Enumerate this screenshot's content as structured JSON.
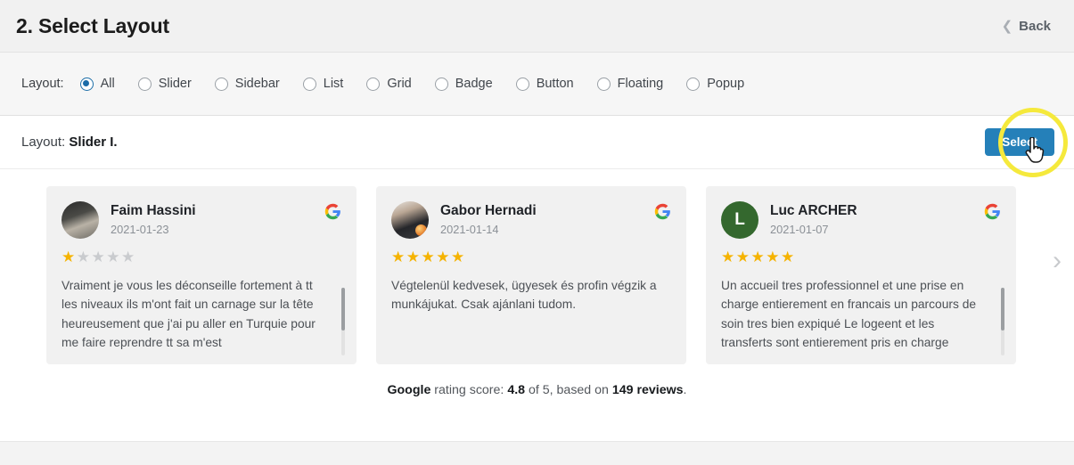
{
  "header": {
    "title": "2. Select Layout",
    "back_label": "Back",
    "back_chevron": "chevron-left"
  },
  "filter": {
    "label": "Layout:",
    "options": [
      {
        "label": "All",
        "checked": true
      },
      {
        "label": "Slider",
        "checked": false
      },
      {
        "label": "Sidebar",
        "checked": false
      },
      {
        "label": "List",
        "checked": false
      },
      {
        "label": "Grid",
        "checked": false
      },
      {
        "label": "Badge",
        "checked": false
      },
      {
        "label": "Button",
        "checked": false
      },
      {
        "label": "Floating",
        "checked": false
      },
      {
        "label": "Popup",
        "checked": false
      }
    ]
  },
  "preview": {
    "caption_prefix": "Layout:",
    "caption_name": "Slider I.",
    "select_label": "Select",
    "next_arrow": "›",
    "highlight_color": "#f5e93c",
    "select_button_color": "#2580b9"
  },
  "reviews": [
    {
      "name": "Faim Hassini",
      "date": "2021-01-23",
      "rating": 1,
      "avatar_type": "photo",
      "avatar_letter": "",
      "source_icon": "google-g-icon",
      "text": "Vraiment je vous les déconseille fortement à tt les niveaux ils m'ont fait un carnage sur la tête heureusement que j'ai pu aller en Turquie pour me faire reprendre tt sa m'est",
      "has_scrollbar": true
    },
    {
      "name": "Gabor Hernadi",
      "date": "2021-01-14",
      "rating": 5,
      "avatar_type": "photo",
      "avatar_letter": "",
      "source_icon": "google-g-icon",
      "text": "Végtelenül kedvesek, ügyesek és profin végzik a munkájukat. Csak ajánlani tudom.",
      "has_scrollbar": false
    },
    {
      "name": "Luc ARCHER",
      "date": "2021-01-07",
      "rating": 5,
      "avatar_type": "letter",
      "avatar_letter": "L",
      "source_icon": "google-g-icon",
      "text": "Un accueil tres professionnel et une prise en charge entierement en francais un parcours de soin tres bien expiqué Le logeent et les transferts sont entierement pris en charge",
      "has_scrollbar": true
    }
  ],
  "footer": {
    "brand": "Google",
    "mid_text": " rating score: ",
    "score": "4.8",
    "of_text": " of 5, based on ",
    "count": "149 reviews",
    "end_text": "."
  }
}
